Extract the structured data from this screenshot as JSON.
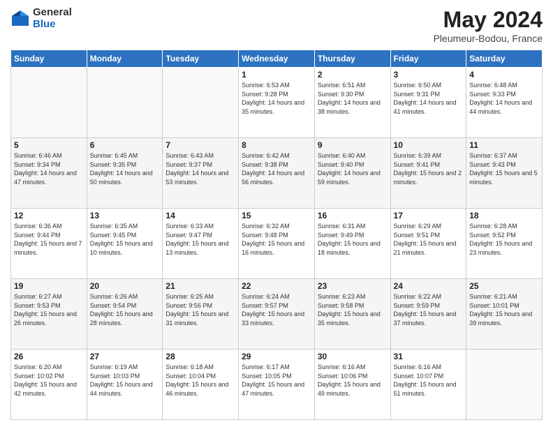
{
  "logo": {
    "general": "General",
    "blue": "Blue"
  },
  "header": {
    "month": "May 2024",
    "location": "Pleumeur-Bodou, France"
  },
  "weekdays": [
    "Sunday",
    "Monday",
    "Tuesday",
    "Wednesday",
    "Thursday",
    "Friday",
    "Saturday"
  ],
  "weeks": [
    [
      {
        "day": "",
        "info": ""
      },
      {
        "day": "",
        "info": ""
      },
      {
        "day": "",
        "info": ""
      },
      {
        "day": "1",
        "info": "Sunrise: 6:53 AM\nSunset: 9:28 PM\nDaylight: 14 hours\nand 35 minutes."
      },
      {
        "day": "2",
        "info": "Sunrise: 6:51 AM\nSunset: 9:30 PM\nDaylight: 14 hours\nand 38 minutes."
      },
      {
        "day": "3",
        "info": "Sunrise: 6:50 AM\nSunset: 9:31 PM\nDaylight: 14 hours\nand 41 minutes."
      },
      {
        "day": "4",
        "info": "Sunrise: 6:48 AM\nSunset: 9:33 PM\nDaylight: 14 hours\nand 44 minutes."
      }
    ],
    [
      {
        "day": "5",
        "info": "Sunrise: 6:46 AM\nSunset: 9:34 PM\nDaylight: 14 hours\nand 47 minutes."
      },
      {
        "day": "6",
        "info": "Sunrise: 6:45 AM\nSunset: 9:35 PM\nDaylight: 14 hours\nand 50 minutes."
      },
      {
        "day": "7",
        "info": "Sunrise: 6:43 AM\nSunset: 9:37 PM\nDaylight: 14 hours\nand 53 minutes."
      },
      {
        "day": "8",
        "info": "Sunrise: 6:42 AM\nSunset: 9:38 PM\nDaylight: 14 hours\nand 56 minutes."
      },
      {
        "day": "9",
        "info": "Sunrise: 6:40 AM\nSunset: 9:40 PM\nDaylight: 14 hours\nand 59 minutes."
      },
      {
        "day": "10",
        "info": "Sunrise: 6:39 AM\nSunset: 9:41 PM\nDaylight: 15 hours\nand 2 minutes."
      },
      {
        "day": "11",
        "info": "Sunrise: 6:37 AM\nSunset: 9:43 PM\nDaylight: 15 hours\nand 5 minutes."
      }
    ],
    [
      {
        "day": "12",
        "info": "Sunrise: 6:36 AM\nSunset: 9:44 PM\nDaylight: 15 hours\nand 7 minutes."
      },
      {
        "day": "13",
        "info": "Sunrise: 6:35 AM\nSunset: 9:45 PM\nDaylight: 15 hours\nand 10 minutes."
      },
      {
        "day": "14",
        "info": "Sunrise: 6:33 AM\nSunset: 9:47 PM\nDaylight: 15 hours\nand 13 minutes."
      },
      {
        "day": "15",
        "info": "Sunrise: 6:32 AM\nSunset: 9:48 PM\nDaylight: 15 hours\nand 16 minutes."
      },
      {
        "day": "16",
        "info": "Sunrise: 6:31 AM\nSunset: 9:49 PM\nDaylight: 15 hours\nand 18 minutes."
      },
      {
        "day": "17",
        "info": "Sunrise: 6:29 AM\nSunset: 9:51 PM\nDaylight: 15 hours\nand 21 minutes."
      },
      {
        "day": "18",
        "info": "Sunrise: 6:28 AM\nSunset: 9:52 PM\nDaylight: 15 hours\nand 23 minutes."
      }
    ],
    [
      {
        "day": "19",
        "info": "Sunrise: 6:27 AM\nSunset: 9:53 PM\nDaylight: 15 hours\nand 26 minutes."
      },
      {
        "day": "20",
        "info": "Sunrise: 6:26 AM\nSunset: 9:54 PM\nDaylight: 15 hours\nand 28 minutes."
      },
      {
        "day": "21",
        "info": "Sunrise: 6:25 AM\nSunset: 9:56 PM\nDaylight: 15 hours\nand 31 minutes."
      },
      {
        "day": "22",
        "info": "Sunrise: 6:24 AM\nSunset: 9:57 PM\nDaylight: 15 hours\nand 33 minutes."
      },
      {
        "day": "23",
        "info": "Sunrise: 6:23 AM\nSunset: 9:58 PM\nDaylight: 15 hours\nand 35 minutes."
      },
      {
        "day": "24",
        "info": "Sunrise: 6:22 AM\nSunset: 9:59 PM\nDaylight: 15 hours\nand 37 minutes."
      },
      {
        "day": "25",
        "info": "Sunrise: 6:21 AM\nSunset: 10:01 PM\nDaylight: 15 hours\nand 39 minutes."
      }
    ],
    [
      {
        "day": "26",
        "info": "Sunrise: 6:20 AM\nSunset: 10:02 PM\nDaylight: 15 hours\nand 42 minutes."
      },
      {
        "day": "27",
        "info": "Sunrise: 6:19 AM\nSunset: 10:03 PM\nDaylight: 15 hours\nand 44 minutes."
      },
      {
        "day": "28",
        "info": "Sunrise: 6:18 AM\nSunset: 10:04 PM\nDaylight: 15 hours\nand 46 minutes."
      },
      {
        "day": "29",
        "info": "Sunrise: 6:17 AM\nSunset: 10:05 PM\nDaylight: 15 hours\nand 47 minutes."
      },
      {
        "day": "30",
        "info": "Sunrise: 6:16 AM\nSunset: 10:06 PM\nDaylight: 15 hours\nand 49 minutes."
      },
      {
        "day": "31",
        "info": "Sunrise: 6:16 AM\nSunset: 10:07 PM\nDaylight: 15 hours\nand 51 minutes."
      },
      {
        "day": "",
        "info": ""
      }
    ]
  ]
}
